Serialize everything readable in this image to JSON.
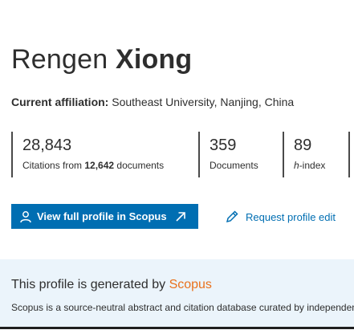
{
  "profile": {
    "first_name": "Rengen",
    "last_name": "Xiong",
    "affiliation_label": "Current affiliation:",
    "affiliation_value": "Southeast University, Nanjing, China"
  },
  "metrics": {
    "citations": {
      "value": "28,843",
      "label_prefix": "Citations from",
      "label_count": "12,642",
      "label_suffix": "documents"
    },
    "documents": {
      "value": "359",
      "label": "Documents"
    },
    "hindex": {
      "value": "89",
      "label_italic": "h",
      "label_rest": "-index"
    }
  },
  "actions": {
    "view_profile": "View full profile in Scopus",
    "request_edit": "Request profile edit"
  },
  "banner": {
    "title_prefix": "This profile is generated by",
    "title_brand": "Scopus",
    "description": "Scopus is a source-neutral abstract and citation database curated by independent subject matter experts."
  },
  "colors": {
    "primary": "#006eb2",
    "brand_orange": "#e9711c",
    "banner_bg": "#ebf4fb",
    "text": "#2e2e2e"
  },
  "icons": {
    "view_profile_leading": "person-icon",
    "view_profile_trailing": "external-arrow-icon",
    "request_edit": "pencil-icon"
  }
}
